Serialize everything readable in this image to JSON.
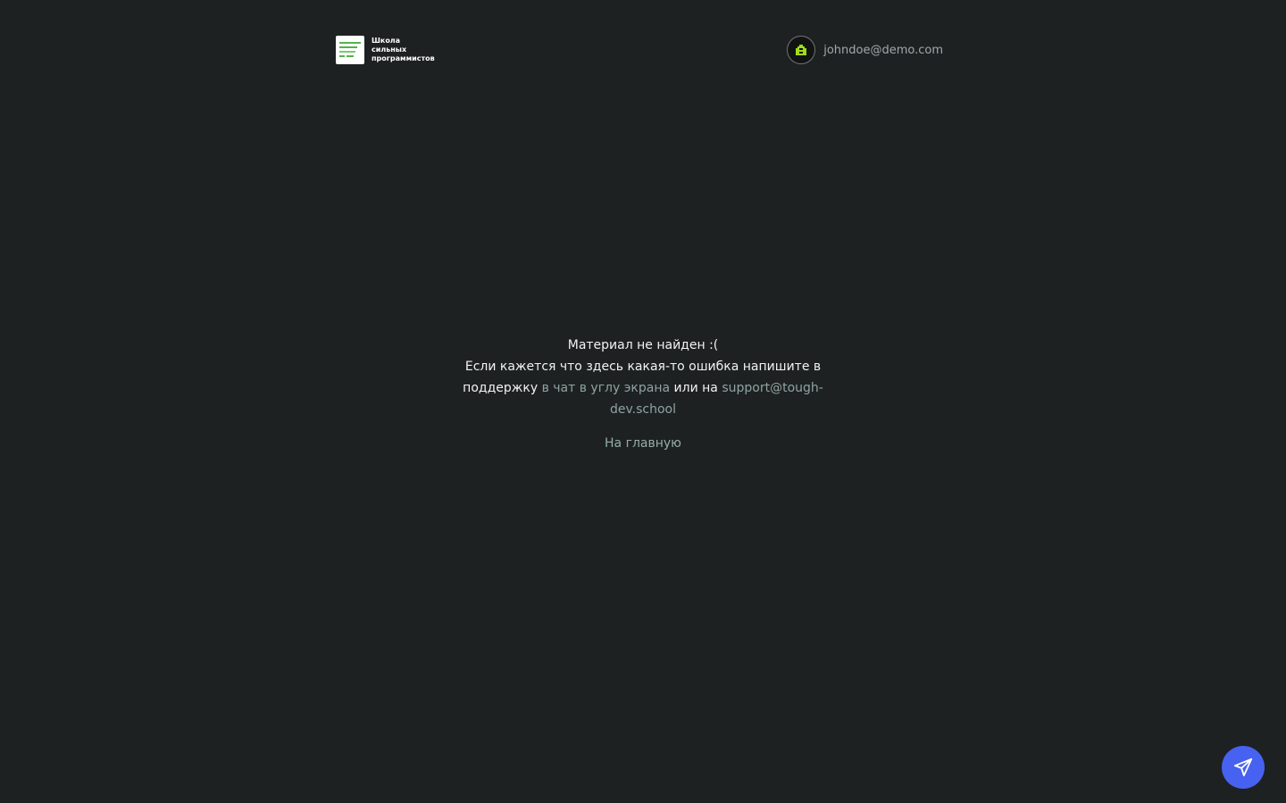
{
  "header": {
    "logo": {
      "lines": [
        "Школа",
        "сильных",
        "программистов"
      ],
      "icon": "school-logo-icon",
      "colors": {
        "tile": "#ffffff",
        "stripes": "#55b24a"
      }
    },
    "user": {
      "email": "johndoe@demo.com",
      "avatar_icon": "pixel-avatar-icon",
      "avatar_color": "#9fdc1a"
    }
  },
  "message": {
    "title": "Материал не найден :(",
    "text_before": "Если кажется что здесь какая-то ошибка напишите в поддержку",
    "chat_link": "в чат в углу экрана",
    "text_middle": "или на",
    "email_link": "support@tough-dev.school"
  },
  "home_link": "На главную",
  "chat_widget": {
    "icon": "paper-plane-icon",
    "color": "#4762f0"
  },
  "colors": {
    "background": "#1e2122",
    "link": "#8ea4a0"
  }
}
